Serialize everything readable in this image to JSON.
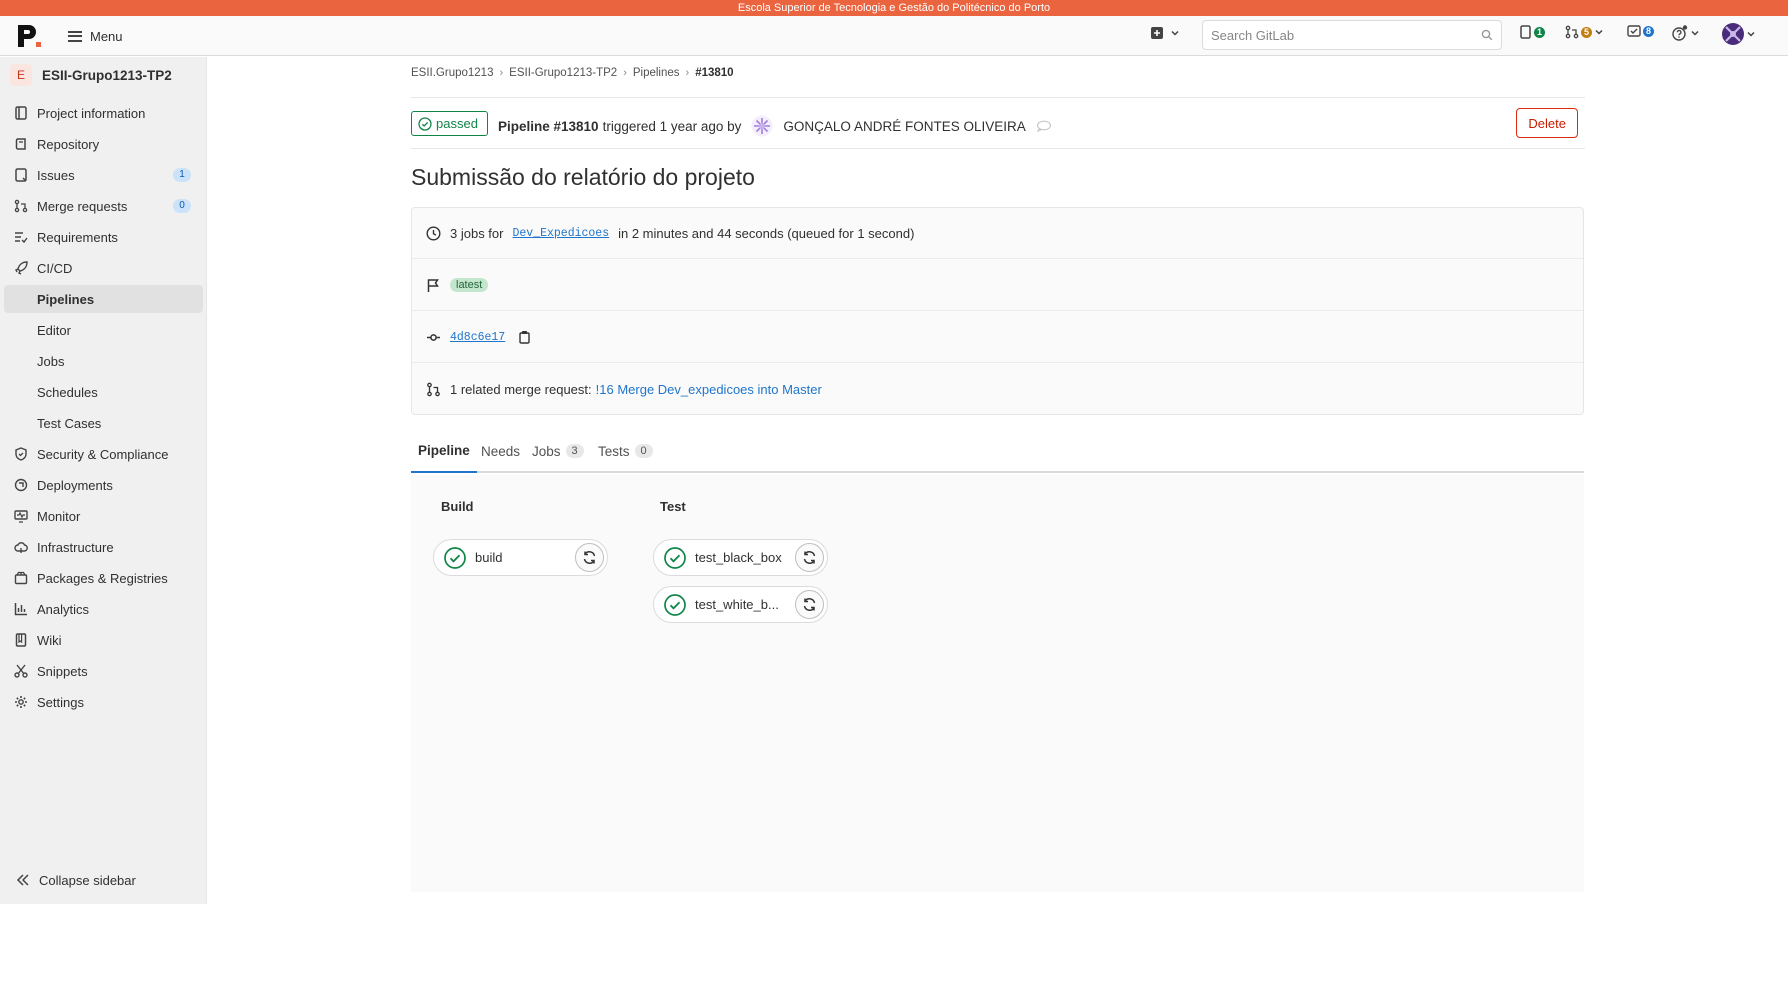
{
  "system_bar": {
    "text": "Escola Superior de Tecnologia e Gestão do Politécnico do Porto"
  },
  "topnav": {
    "logo_alt": "P.",
    "menu_label": "Menu",
    "search_placeholder": "Search GitLab",
    "issues_count": "1",
    "mr_count": "5",
    "todo_count": "8"
  },
  "sidebar": {
    "project_initial": "E",
    "project_name": "ESII-Grupo1213-TP2",
    "items": [
      {
        "label": "Project information",
        "icon": "document-icon"
      },
      {
        "label": "Repository",
        "icon": "repository-icon"
      },
      {
        "label": "Issues",
        "icon": "issues-icon",
        "badge": "1"
      },
      {
        "label": "Merge requests",
        "icon": "merge-request-icon",
        "badge": "0"
      },
      {
        "label": "Requirements",
        "icon": "requirements-icon"
      },
      {
        "label": "CI/CD",
        "icon": "rocket-icon"
      },
      {
        "label": "Pipelines"
      },
      {
        "label": "Editor"
      },
      {
        "label": "Jobs"
      },
      {
        "label": "Schedules"
      },
      {
        "label": "Test Cases"
      },
      {
        "label": "Security & Compliance",
        "icon": "shield-icon"
      },
      {
        "label": "Deployments",
        "icon": "deployments-icon"
      },
      {
        "label": "Monitor",
        "icon": "monitor-icon"
      },
      {
        "label": "Infrastructure",
        "icon": "cloud-icon"
      },
      {
        "label": "Packages & Registries",
        "icon": "package-icon"
      },
      {
        "label": "Analytics",
        "icon": "chart-icon"
      },
      {
        "label": "Wiki",
        "icon": "book-icon"
      },
      {
        "label": "Snippets",
        "icon": "scissors-icon"
      },
      {
        "label": "Settings",
        "icon": "gear-icon"
      }
    ],
    "collapse_label": "Collapse sidebar"
  },
  "breadcrumb": [
    "ESII.Grupo1213",
    "ESII-Grupo1213-TP2",
    "Pipelines",
    "#13810"
  ],
  "pipeline": {
    "status": "passed",
    "label": "Pipeline #13810",
    "triggered_text": "triggered 1 year ago by",
    "user": "GONÇALO ANDRÉ FONTES OLIVEIRA",
    "delete_label": "Delete",
    "title": "Submissão do relatório do projeto",
    "jobs_prefix": "3 jobs for",
    "branch": "Dev_Expedicoes",
    "jobs_suffix": "in 2 minutes and 44 seconds (queued for 1 second)",
    "tag": "latest",
    "commit_sha": "4d8c6e17",
    "mr_prefix": "1 related merge request:",
    "mr_link": "!16 Merge Dev_expedicoes into Master"
  },
  "tabs": [
    {
      "label": "Pipeline"
    },
    {
      "label": "Needs"
    },
    {
      "label": "Jobs",
      "count": "3"
    },
    {
      "label": "Tests",
      "count": "0"
    }
  ],
  "stages": [
    {
      "name": "Build",
      "jobs": [
        "build"
      ]
    },
    {
      "name": "Test",
      "jobs": [
        "test_black_box",
        "test_white_b..."
      ]
    }
  ],
  "colors": {
    "success": "#108548",
    "danger": "#dd2b0e",
    "link": "#1f75cb",
    "brand_bar": "#e9643f"
  }
}
